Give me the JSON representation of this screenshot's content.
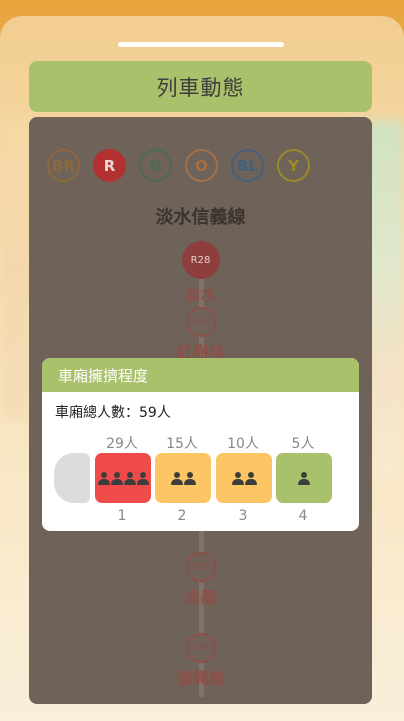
{
  "header": {
    "title": "列車動態"
  },
  "lines": [
    {
      "label": "BR",
      "color": "#8b6a3e"
    },
    {
      "label": "R",
      "color": "#b23130",
      "active": true
    },
    {
      "label": "G",
      "color": "#4d6a52"
    },
    {
      "label": "O",
      "color": "#a56f48"
    },
    {
      "label": "BL",
      "color": "#45607c"
    },
    {
      "label": "Y",
      "color": "#9b8a2c"
    }
  ],
  "current_line": "淡水信義線",
  "stations": [
    {
      "code": "R28",
      "name": "淡水",
      "active": true
    },
    {
      "code": "R28",
      "name": "紅樹林"
    },
    {
      "code": "R28",
      "name": "忠義"
    },
    {
      "code": "R28",
      "name": "復興崗"
    }
  ],
  "popup": {
    "title": "車廂擁擠程度",
    "total": "車廂總人數：59人",
    "cars": [
      {
        "count": "29人",
        "number": "1",
        "color": "#f04b4b",
        "people": 4
      },
      {
        "count": "15人",
        "number": "2",
        "color": "#fbc663",
        "people": 2
      },
      {
        "count": "10人",
        "number": "3",
        "color": "#fbc663",
        "people": 2
      },
      {
        "count": "5人",
        "number": "4",
        "color": "#a9c16b",
        "people": 1
      }
    ]
  }
}
